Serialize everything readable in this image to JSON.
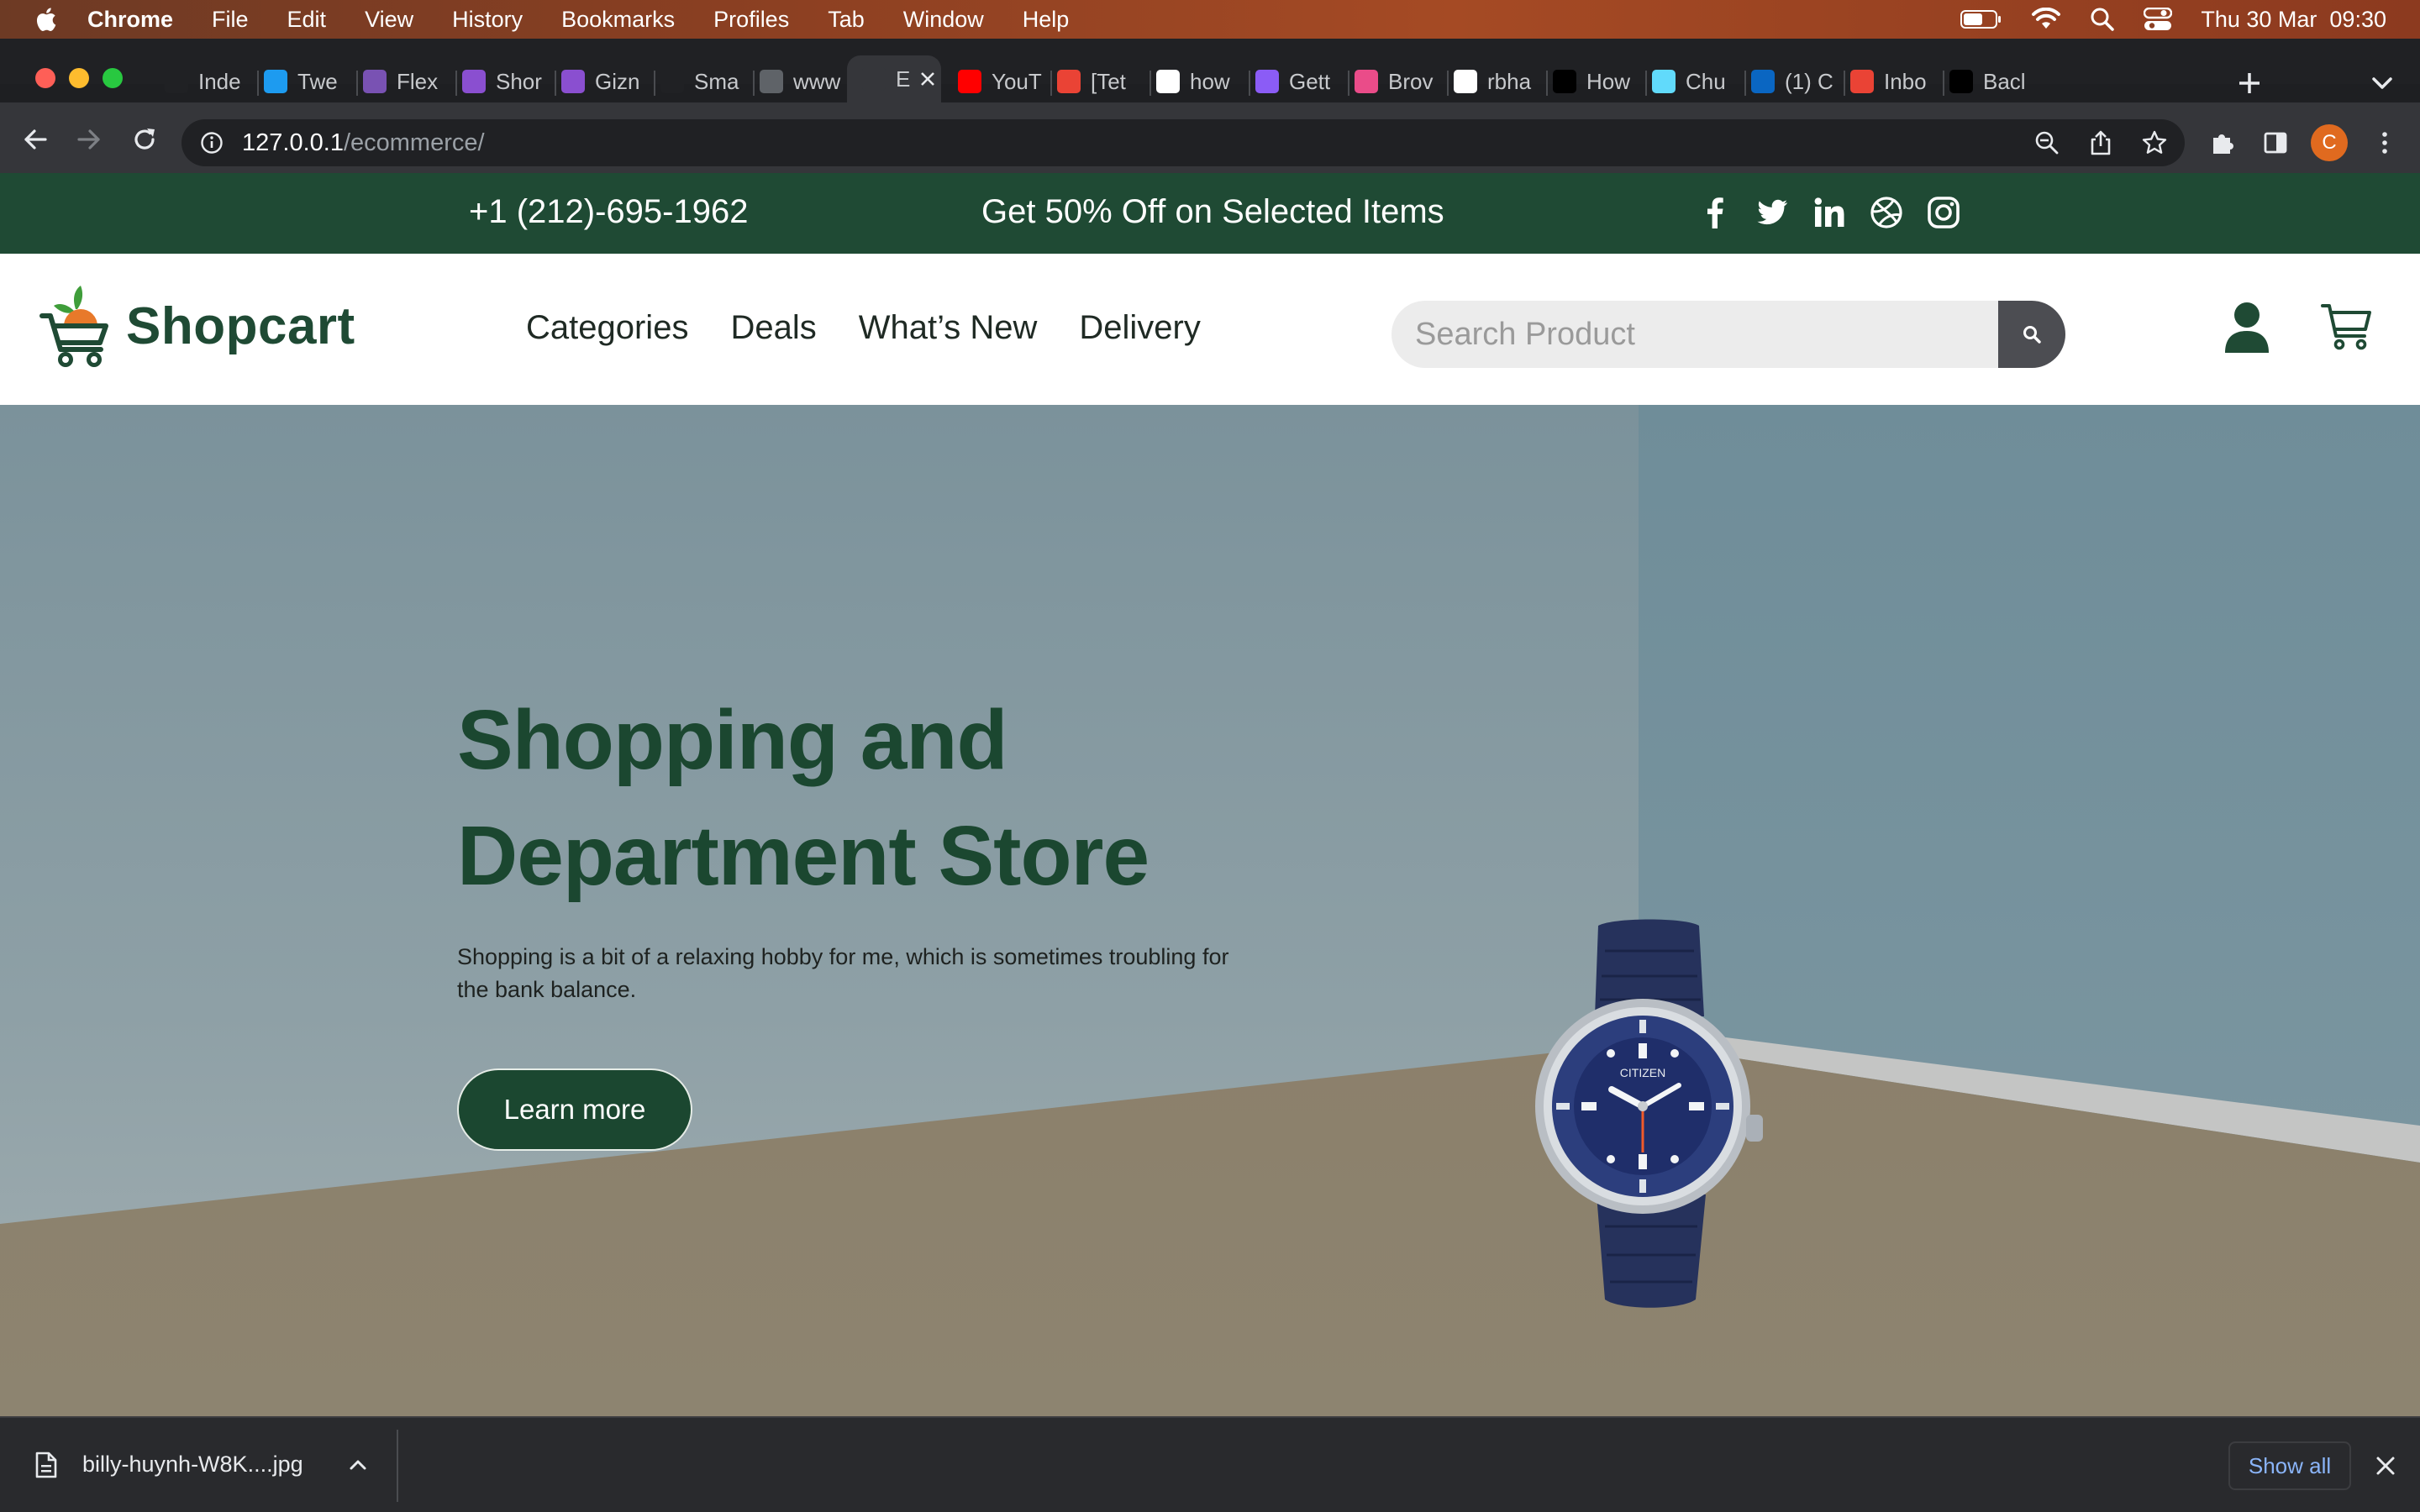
{
  "menubar": {
    "app_name": "Chrome",
    "items": [
      "File",
      "Edit",
      "View",
      "History",
      "Bookmarks",
      "Profiles",
      "Tab",
      "Window",
      "Help"
    ],
    "datetime": "Thu 30 Mar  09:30"
  },
  "tabs": [
    {
      "label": "Inde",
      "icon": "medium-icon",
      "color": "#202124"
    },
    {
      "label": "Twe",
      "icon": "twitter-icon",
      "color": "#1d9bf0"
    },
    {
      "label": "Flex",
      "icon": "bootstrap-icon",
      "color": "#7952b3"
    },
    {
      "label": "Shor",
      "icon": "w-icon",
      "color": "#8a4fd0"
    },
    {
      "label": "Gizn",
      "icon": "w-icon",
      "color": "#8a4fd0"
    },
    {
      "label": "Sma",
      "icon": "grammarly-icon",
      "color": "#202124"
    },
    {
      "label": "www",
      "icon": "globe-icon",
      "color": "#5f6368"
    },
    {
      "label": "E",
      "icon": "shopcart-icon",
      "color": "#35363a",
      "active": true
    },
    {
      "label": "YouT",
      "icon": "youtube-icon",
      "color": "#ff0000"
    },
    {
      "label": "[Tet",
      "icon": "gmail-icon",
      "color": "#ea4335"
    },
    {
      "label": "how",
      "icon": "google-icon",
      "color": "#ffffff"
    },
    {
      "label": "Gett",
      "icon": "vite-icon",
      "color": "#8b5cf6"
    },
    {
      "label": "Brov",
      "icon": "dribbble-icon",
      "color": "#ea4c89"
    },
    {
      "label": "rbha",
      "icon": "github-icon",
      "color": "#ffffff"
    },
    {
      "label": "How",
      "icon": "dev-icon",
      "color": "#000000"
    },
    {
      "label": "Chu",
      "icon": "react-icon",
      "color": "#61dafb"
    },
    {
      "label": "(1) C",
      "icon": "linkedin-icon",
      "color": "#0a66c2"
    },
    {
      "label": "Inbo",
      "icon": "gmail-icon",
      "color": "#ea4335"
    },
    {
      "label": "Bacl",
      "icon": "unsplash-icon",
      "color": "#000000"
    }
  ],
  "toolbar": {
    "url_host": "127.0.0.1",
    "url_path": "/ecommerce/",
    "profile_initial": "C"
  },
  "site": {
    "topbar": {
      "phone": "+1 (212)-695-1962",
      "promo": "Get 50% Off on Selected Items"
    },
    "brand": "Shopcart",
    "nav": [
      "Categories",
      "Deals",
      "What’s New",
      "Delivery"
    ],
    "search_placeholder": "Search Product",
    "hero": {
      "title_line1": "Shopping and",
      "title_line2": "Department Store",
      "text": "Shopping is a bit of a relaxing hobby for me, which is sometimes troubling for the bank balance.",
      "button": "Learn more"
    },
    "watch_brand": "CITIZEN"
  },
  "downloads": {
    "filename": "billy-huynh-W8K....jpg",
    "show_all": "Show all"
  },
  "colors": {
    "brand_green": "#1f4a34",
    "accent_orange": "#e8792a"
  }
}
